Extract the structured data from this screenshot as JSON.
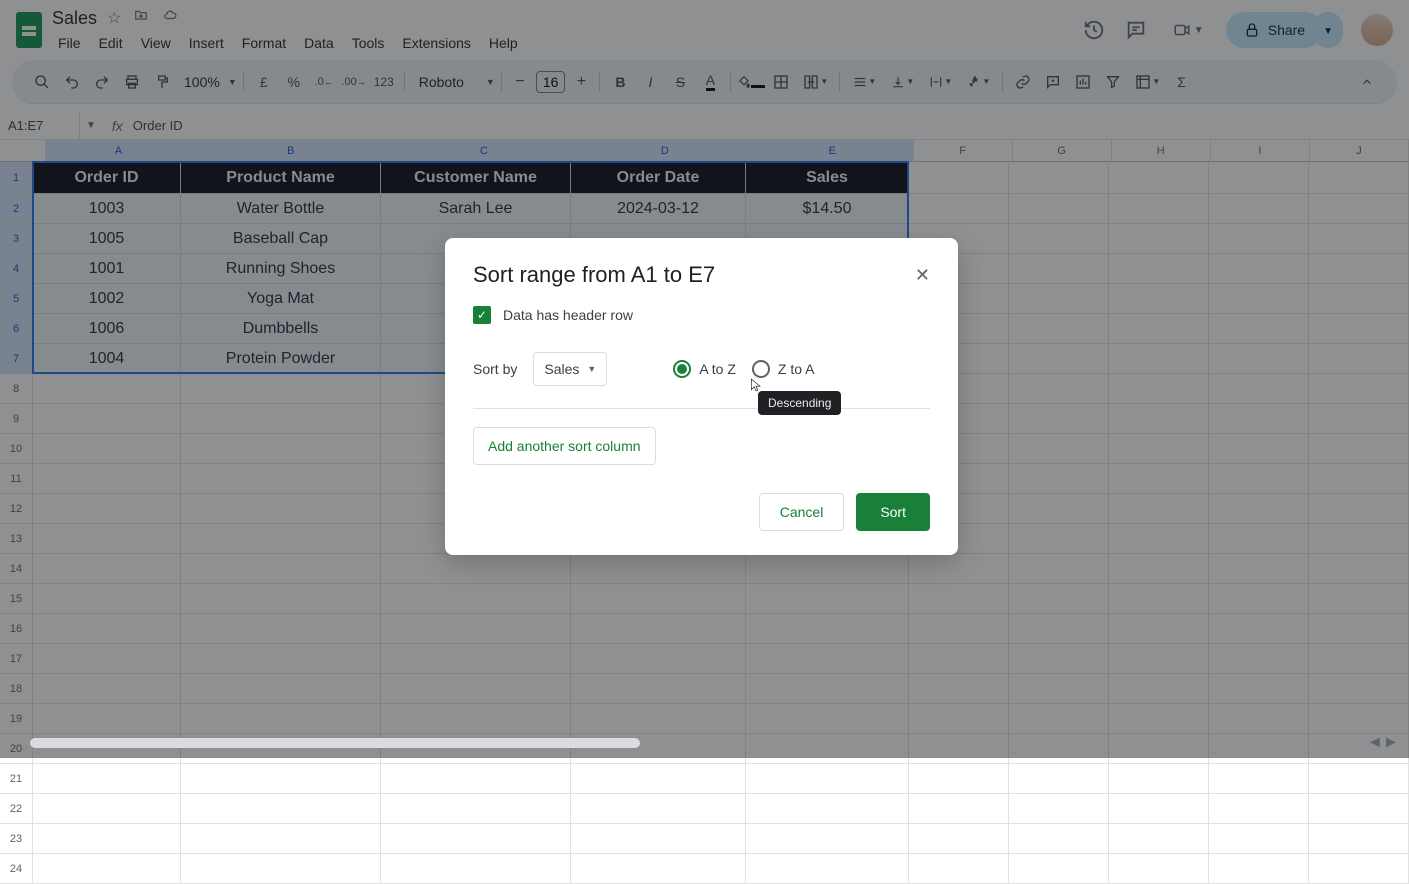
{
  "doc": {
    "title": "Sales"
  },
  "menus": [
    "File",
    "Edit",
    "View",
    "Insert",
    "Format",
    "Data",
    "Tools",
    "Extensions",
    "Help"
  ],
  "header_share": "Share",
  "toolbar": {
    "zoom": "100%",
    "font": "Roboto",
    "font_size": "16"
  },
  "namebox": "A1:E7",
  "formula_value": "Order ID",
  "columns": [
    "A",
    "B",
    "C",
    "D",
    "E",
    "F",
    "G",
    "H",
    "I",
    "J"
  ],
  "table": {
    "headers": [
      "Order ID",
      "Product Name",
      "Customer Name",
      "Order Date",
      "Sales"
    ],
    "rows": [
      [
        "1003",
        "Water Bottle",
        "Sarah Lee",
        "2024-03-12",
        "$14.50"
      ],
      [
        "1005",
        "Baseball Cap",
        "",
        "",
        ""
      ],
      [
        "1001",
        "Running Shoes",
        "",
        "",
        ""
      ],
      [
        "1002",
        "Yoga Mat",
        "",
        "",
        ""
      ],
      [
        "1006",
        "Dumbbells",
        "",
        "",
        ""
      ],
      [
        "1004",
        "Protein Powder",
        "",
        "",
        ""
      ]
    ]
  },
  "dialog": {
    "title": "Sort range from A1 to E7",
    "header_checkbox": "Data has header row",
    "sortby_label": "Sort by",
    "sortby_value": "Sales",
    "radio_a": "A to Z",
    "radio_z": "Z to A",
    "add_column": "Add another sort column",
    "cancel": "Cancel",
    "sort": "Sort",
    "tooltip": "Descending"
  }
}
